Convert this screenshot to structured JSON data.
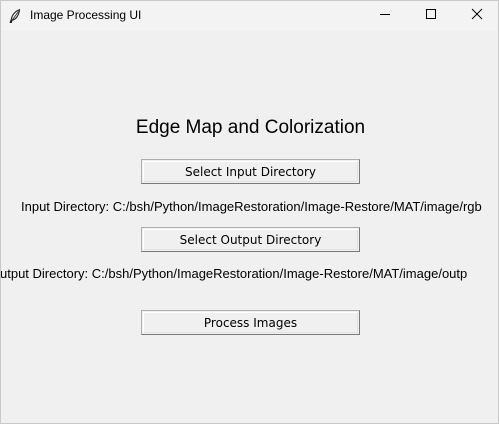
{
  "window": {
    "title": "Image Processing UI",
    "controls": {
      "minimize": "minimize-icon",
      "maximize": "maximize-icon",
      "close": "close-icon"
    }
  },
  "main": {
    "heading": "Edge Map and Colorization",
    "select_input_label": "Select Input Directory",
    "input_path_text": "Input Directory: C:/bsh/Python/ImageRestoration/Image-Restore/MAT/image/rgb",
    "select_output_label": "Select Output Directory",
    "output_path_text": "utput Directory: C:/bsh/Python/ImageRestoration/Image-Restore/MAT/image/outp",
    "process_label": "Process Images"
  },
  "colors": {
    "background": "#f0f0f0",
    "titlebar": "#f3f3f3",
    "button_border": "#adadad"
  }
}
